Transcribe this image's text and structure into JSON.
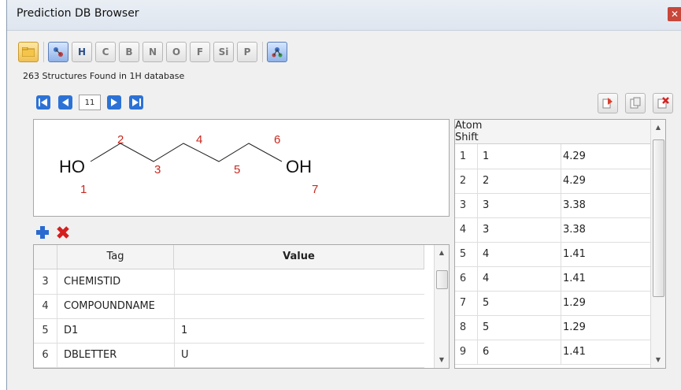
{
  "window": {
    "title": "Prediction DB Browser"
  },
  "toolbar": {
    "buttons": [
      {
        "letter": "",
        "name": "open-folder"
      },
      {
        "letter": "",
        "name": "atom-structure"
      },
      {
        "letter": "H",
        "name": "H"
      },
      {
        "letter": "C",
        "name": "C"
      },
      {
        "letter": "B",
        "name": "B"
      },
      {
        "letter": "N",
        "name": "N"
      },
      {
        "letter": "O",
        "name": "O"
      },
      {
        "letter": "F",
        "name": "F"
      },
      {
        "letter": "Si",
        "name": "Si"
      },
      {
        "letter": "P",
        "name": "P"
      },
      {
        "letter": "",
        "name": "database-structure"
      }
    ]
  },
  "status": "263 Structures Found in 1H database",
  "navigation": {
    "current": "11"
  },
  "molecule": {
    "labels": {
      "ho": "HO",
      "oh": "OH"
    },
    "atom_numbers": [
      "1",
      "2",
      "3",
      "4",
      "5",
      "6",
      "7"
    ]
  },
  "tag_table": {
    "headers": {
      "tag": "Tag",
      "value": "Value"
    },
    "rows": [
      {
        "num": "3",
        "tag": "CHEMISTID",
        "value": ""
      },
      {
        "num": "4",
        "tag": "COMPOUNDNAME",
        "value": ""
      },
      {
        "num": "5",
        "tag": "D1",
        "value": "1"
      },
      {
        "num": "6",
        "tag": "DBLETTER",
        "value": "U"
      }
    ]
  },
  "shift_table": {
    "headers": {
      "atom": "Atom",
      "shift": "Shift"
    },
    "rows": [
      {
        "num": "1",
        "atom": "1",
        "shift": "4.29"
      },
      {
        "num": "2",
        "atom": "2",
        "shift": "4.29"
      },
      {
        "num": "3",
        "atom": "3",
        "shift": "3.38"
      },
      {
        "num": "4",
        "atom": "3",
        "shift": "3.38"
      },
      {
        "num": "5",
        "atom": "4",
        "shift": "1.41"
      },
      {
        "num": "6",
        "atom": "4",
        "shift": "1.41"
      },
      {
        "num": "7",
        "atom": "5",
        "shift": "1.29"
      },
      {
        "num": "8",
        "atom": "5",
        "shift": "1.29"
      },
      {
        "num": "9",
        "atom": "6",
        "shift": "1.41"
      }
    ]
  },
  "colors": {
    "atom_number": "#c8281e",
    "nav_blue": "#1e63c8"
  }
}
